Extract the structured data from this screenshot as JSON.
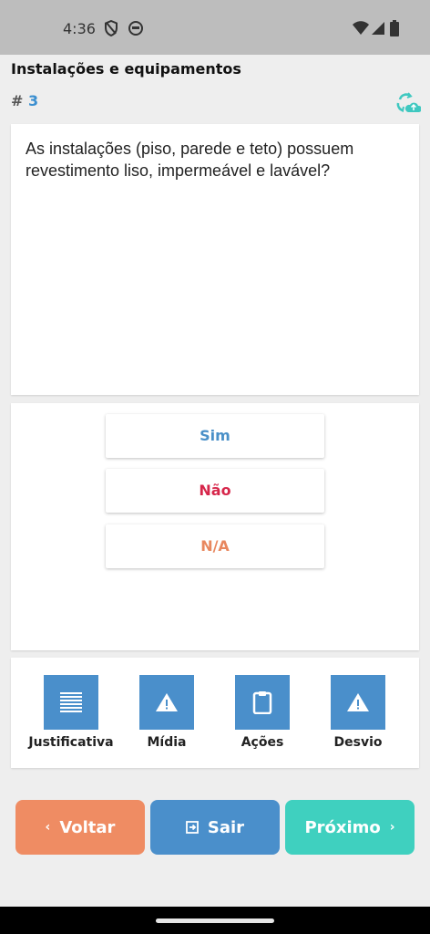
{
  "status_bar": {
    "time": "4:36",
    "icons": [
      "shield-icon",
      "face-icon",
      "wifi-icon",
      "signal-icon",
      "battery-icon"
    ]
  },
  "header": {
    "title": "Instalações e equipamentos",
    "question_hash": "#",
    "question_number": "3",
    "sync_icon": "cloud-sync-icon"
  },
  "question": {
    "text": "As instalações (piso, parede e teto) possuem revestimento liso, impermeável e lavável?"
  },
  "answers": {
    "sim": "Sim",
    "nao": "Não",
    "na": "N/A"
  },
  "tools": {
    "justificativa": "Justificativa",
    "midia": "Mídia",
    "acoes": "Ações",
    "desvio": "Desvio"
  },
  "navigation": {
    "back": "Voltar",
    "exit": "Sair",
    "next": "Próximo"
  },
  "colors": {
    "primary": "#4a8fcb",
    "back": "#ef8c63",
    "next": "#3fd0bf",
    "sim": "#4a90c8",
    "nao": "#d6264a",
    "na": "#e8875f"
  }
}
